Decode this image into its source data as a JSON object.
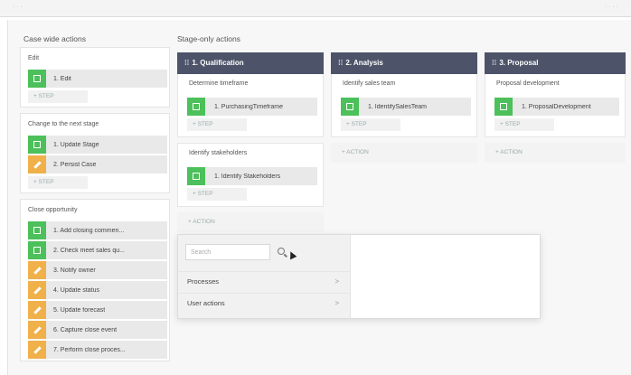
{
  "window": {
    "left_text": "· · ·",
    "right_text": "· · · ·"
  },
  "case_wide": {
    "title": "Case wide actions",
    "groups": [
      {
        "title": "Edit",
        "steps": [
          {
            "label": "1.  Edit",
            "color": "green",
            "icon": "square-icon"
          }
        ],
        "add_step": "+ STEP"
      },
      {
        "title": "Change to the next stage",
        "steps": [
          {
            "label": "1.  Update Stage",
            "color": "green",
            "icon": "square-icon"
          },
          {
            "label": "2.  Persist Case",
            "color": "orange",
            "icon": "pencil-icon"
          }
        ],
        "add_step": "+ STEP"
      },
      {
        "title": "Close opportunity",
        "steps": [
          {
            "label": "1.  Add closing commen...",
            "color": "green",
            "icon": "square-icon"
          },
          {
            "label": "2.  Check meet sales qu...",
            "color": "green",
            "icon": "square-icon"
          },
          {
            "label": "3.  Notify owner",
            "color": "orange",
            "icon": "pencil-icon"
          },
          {
            "label": "4.  Update status",
            "color": "orange",
            "icon": "pencil-icon"
          },
          {
            "label": "5.  Update forecast",
            "color": "orange",
            "icon": "pencil-icon"
          },
          {
            "label": "6.  Capture close event",
            "color": "orange",
            "icon": "pencil-icon"
          },
          {
            "label": "7.  Perform close proces...",
            "color": "orange",
            "icon": "pencil-icon"
          }
        ]
      }
    ]
  },
  "stage_only": {
    "title": "Stage-only actions",
    "stages": [
      {
        "header": "1.  Qualification",
        "processes": [
          {
            "title": "Determine timeframe",
            "step": "1.  PurchasingTimeframe",
            "add_step": "+ STEP"
          },
          {
            "title": "Identify stakeholders",
            "step": "1.  Identify Stakeholders",
            "add_step": "+ STEP"
          }
        ],
        "action": "+ ACTION"
      },
      {
        "header": "2.  Analysis",
        "processes": [
          {
            "title": "Identify sales team",
            "step": "1.  IdentifySalesTeam",
            "add_step": "+ STEP"
          }
        ],
        "action": "+ ACTION"
      },
      {
        "header": "3.  Proposal",
        "processes": [
          {
            "title": "Proposal development",
            "step": "1.  ProposalDevelopment",
            "add_step": "+ STEP"
          }
        ],
        "action": "+ ACTION"
      }
    ]
  },
  "popup": {
    "search_placeholder": "Search",
    "items": [
      {
        "label": "Processes"
      },
      {
        "label": "User actions"
      }
    ],
    "chevron": ">"
  },
  "colors": {
    "stage_header": "#4d5469",
    "green": "#4cc05a",
    "orange": "#f0b04a"
  }
}
